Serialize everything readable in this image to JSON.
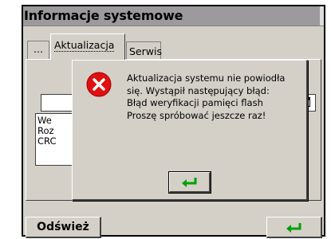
{
  "window": {
    "title": "Informacje systemowe"
  },
  "tabs": [
    {
      "label": "..."
    },
    {
      "label": "Aktualizacja"
    },
    {
      "label": "Serwis"
    }
  ],
  "background": {
    "info_lines": [
      "We",
      "Roz",
      "CRC"
    ],
    "calendar_icon": "calendar-icon"
  },
  "toolbar": {
    "refresh_label": "Odśwież",
    "confirm_icon": "enter-arrow-icon"
  },
  "dialog": {
    "icon": "error-icon",
    "message_lines": [
      "Aktualizacja systemu nie powiodła",
      "się. Wystąpił następujący błąd:",
      "Błąd weryfikacji pamięci flash",
      " Proszę spróbować jeszcze raz!"
    ],
    "ok_icon": "enter-arrow-icon"
  },
  "colors": {
    "accent_green": "#00a000",
    "error_red": "#e01010",
    "titlebar_gray": "#9c9a9c",
    "face_gray": "#d4d0c8"
  }
}
